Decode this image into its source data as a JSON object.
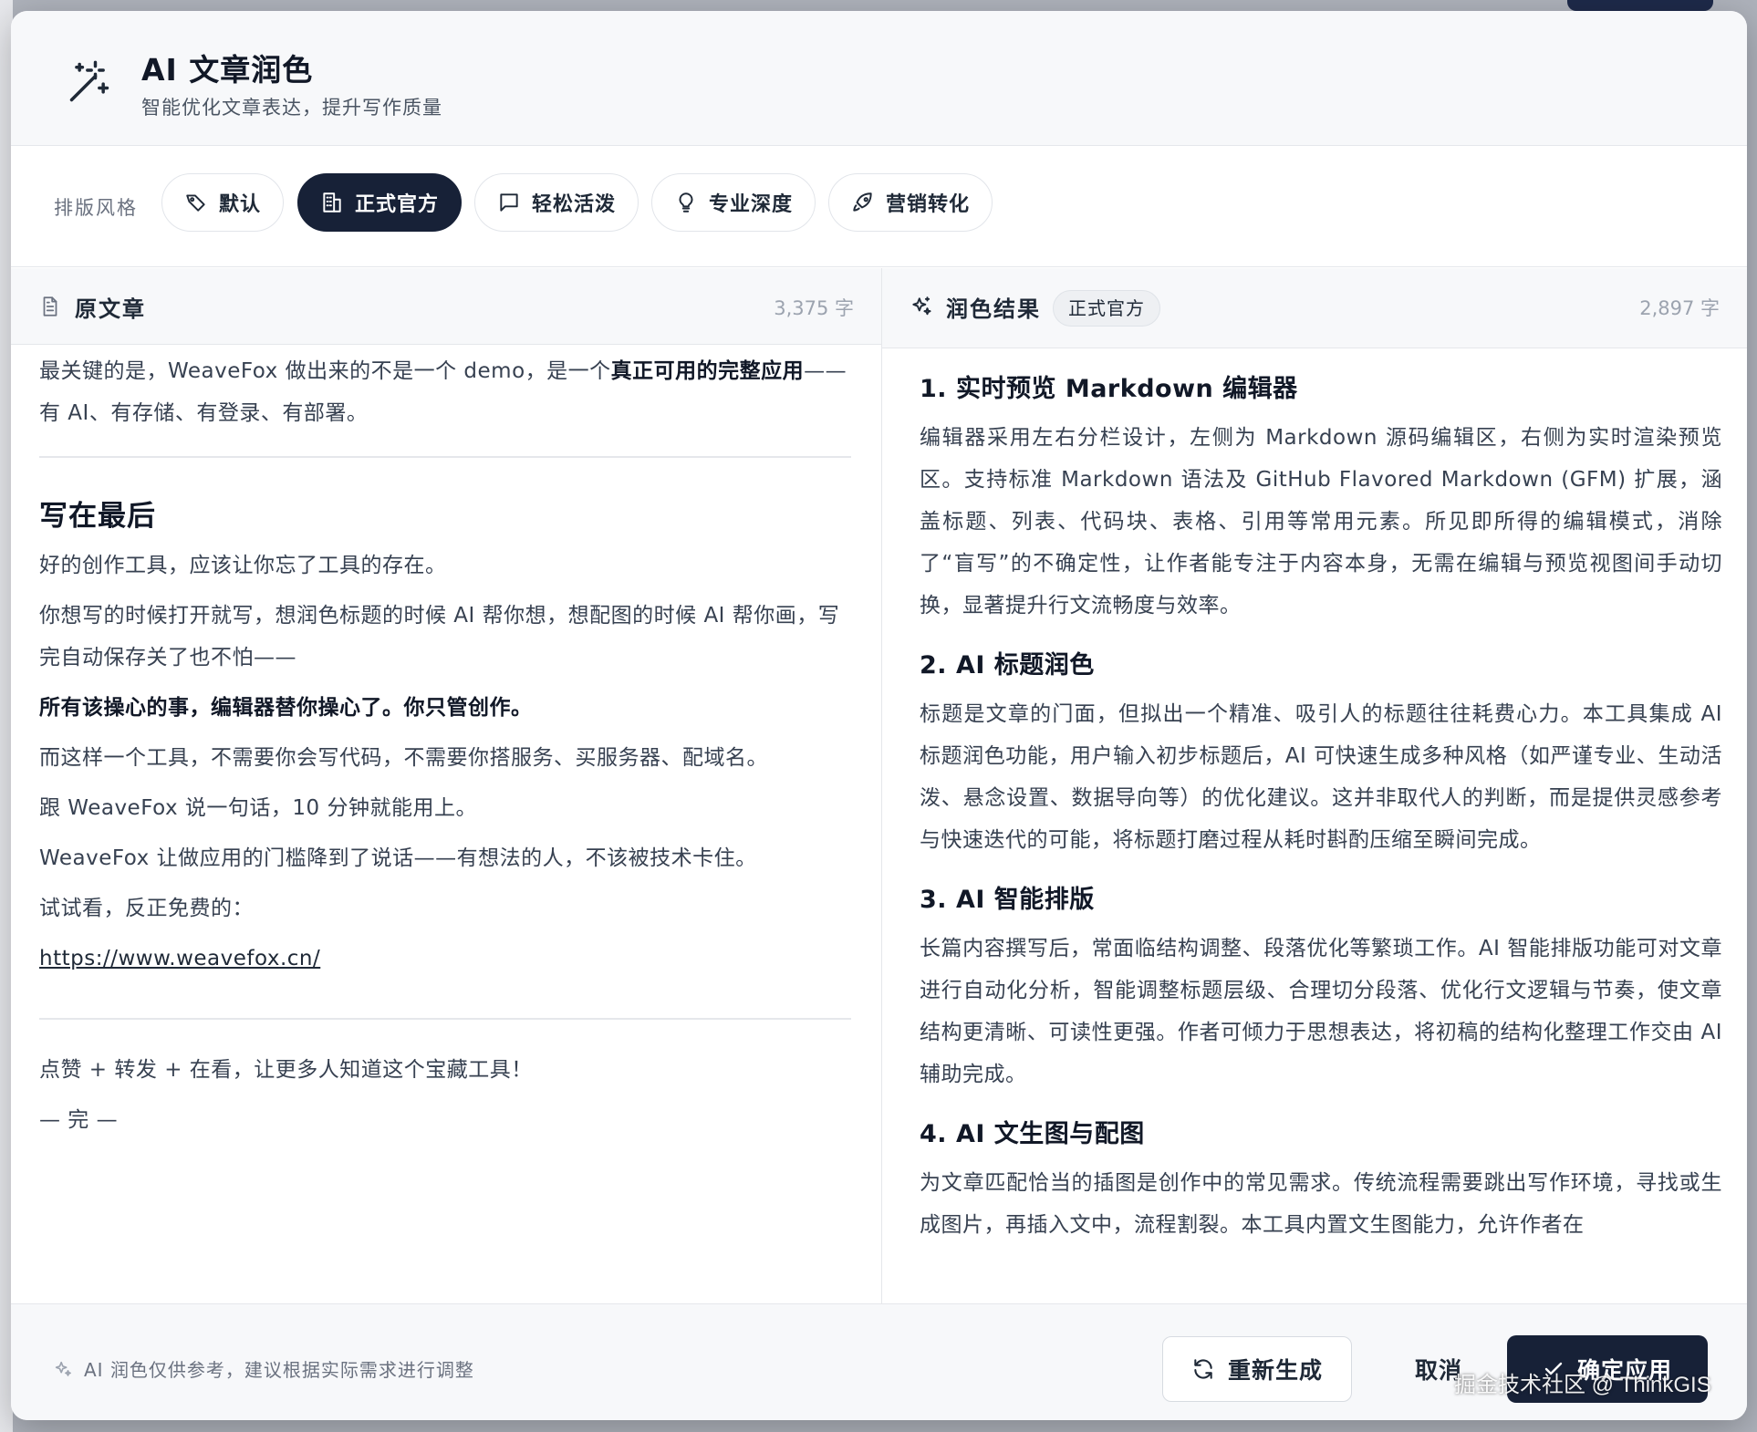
{
  "dialog": {
    "title": "AI 文章润色",
    "subtitle": "智能优化文章表达，提升写作质量",
    "icon": "magic-wand-icon"
  },
  "style_bar": {
    "label": "排版风格",
    "selected": "正式官方",
    "options": [
      {
        "label": "默认",
        "icon": "brush-icon"
      },
      {
        "label": "正式官方",
        "icon": "building-icon"
      },
      {
        "label": "轻松活泼",
        "icon": "chat-bubble-icon"
      },
      {
        "label": "专业深度",
        "icon": "lightbulb-icon"
      },
      {
        "label": "营销转化",
        "icon": "rocket-icon"
      }
    ]
  },
  "original": {
    "title": "原文章",
    "count": "3,375 字",
    "p1_pre": "最关键的是，WeaveFox 做出来的不是一个 demo，是一个",
    "p1_bold": "真正可用的完整应用",
    "p1_post": "——有 AI、有存储、有登录、有部署。",
    "heading": "写在最后",
    "p2": "好的创作工具，应该让你忘了工具的存在。",
    "p3": "你想写的时候打开就写，想润色标题的时候 AI 帮你想，想配图的时候 AI 帮你画，写完自动保存关了也不怕——",
    "p4": "所有该操心的事，编辑器替你操心了。你只管创作。",
    "p5": "而这样一个工具，不需要你会写代码，不需要你搭服务、买服务器、配域名。",
    "p6": "跟 WeaveFox 说一句话，10 分钟就能用上。",
    "p7": "WeaveFox 让做应用的门槛降到了说话——有想法的人，不该被技术卡住。",
    "p8": "试试看，反正免费的：",
    "link": "https://www.weavefox.cn/",
    "p9": "点赞 + 转发 + 在看，让更多人知道这个宝藏工具！",
    "p10": "— 完 —"
  },
  "result": {
    "title": "润色结果",
    "badge": "正式官方",
    "count": "2,897 字",
    "sections": [
      {
        "heading": "1. 实时预览 Markdown 编辑器",
        "text": "编辑器采用左右分栏设计，左侧为 Markdown 源码编辑区，右侧为实时渲染预览区。支持标准 Markdown 语法及 GitHub Flavored Markdown (GFM) 扩展，涵盖标题、列表、代码块、表格、引用等常用元素。所见即所得的编辑模式，消除了“盲写”的不确定性，让作者能专注于内容本身，无需在编辑与预览视图间手动切换，显著提升行文流畅度与效率。"
      },
      {
        "heading": "2. AI 标题润色",
        "text": "标题是文章的门面，但拟出一个精准、吸引人的标题往往耗费心力。本工具集成 AI 标题润色功能，用户输入初步标题后，AI 可快速生成多种风格（如严谨专业、生动活泼、悬念设置、数据导向等）的优化建议。这并非取代人的判断，而是提供灵感参考与快速迭代的可能，将标题打磨过程从耗时斟酌压缩至瞬间完成。"
      },
      {
        "heading": "3. AI 智能排版",
        "text": "长篇内容撰写后，常面临结构调整、段落优化等繁琐工作。AI 智能排版功能可对文章进行自动化分析，智能调整标题层级、合理切分段落、优化行文逻辑与节奏，使文章结构更清晰、可读性更强。作者可倾力于思想表达，将初稿的结构化整理工作交由 AI 辅助完成。"
      },
      {
        "heading": "4. AI 文生图与配图",
        "text": "为文章匹配恰当的插图是创作中的常见需求。传统流程需要跳出写作环境，寻找或生成图片，再插入文中，流程割裂。本工具内置文生图能力，允许作者在"
      }
    ]
  },
  "footer": {
    "note": "AI 润色仅供参考，建议根据实际需求进行调整",
    "regenerate": "重新生成",
    "cancel": "取消",
    "apply": "确定应用"
  },
  "watermark": "掘金技术社区 @ ThinkGIS"
}
